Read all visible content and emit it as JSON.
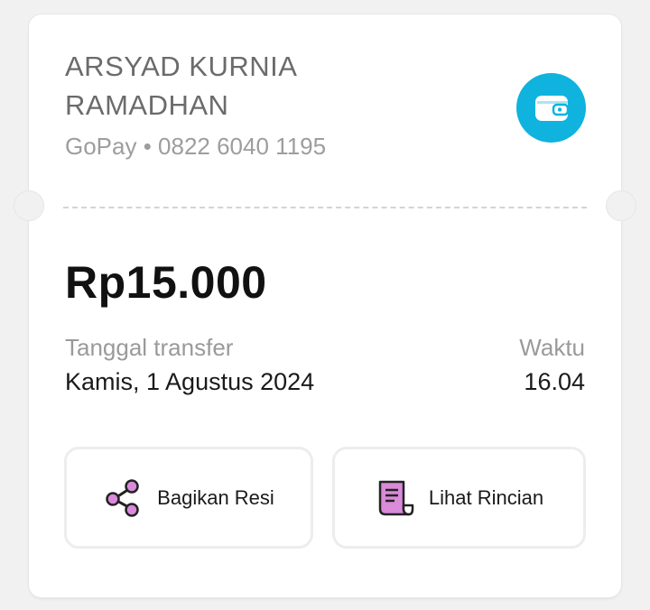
{
  "recipient": {
    "name_line1": "ARSYAD KURNIA",
    "name_line2": "RAMADHAN",
    "subtitle": "GoPay • 0822 6040 1195",
    "icon": "wallet-icon"
  },
  "transfer": {
    "amount": "Rp15.000",
    "date_label": "Tanggal transfer",
    "date_value": "Kamis, 1 Agustus 2024",
    "time_label": "Waktu",
    "time_value": "16.04"
  },
  "actions": {
    "share": {
      "label": "Bagikan Resi",
      "icon": "share-icon"
    },
    "detail": {
      "label": "Lihat Rincian",
      "icon": "receipt-icon"
    }
  },
  "colors": {
    "accent": "#0fb3dd",
    "icon_fill": "#d98ad9",
    "icon_stroke": "#222222"
  }
}
